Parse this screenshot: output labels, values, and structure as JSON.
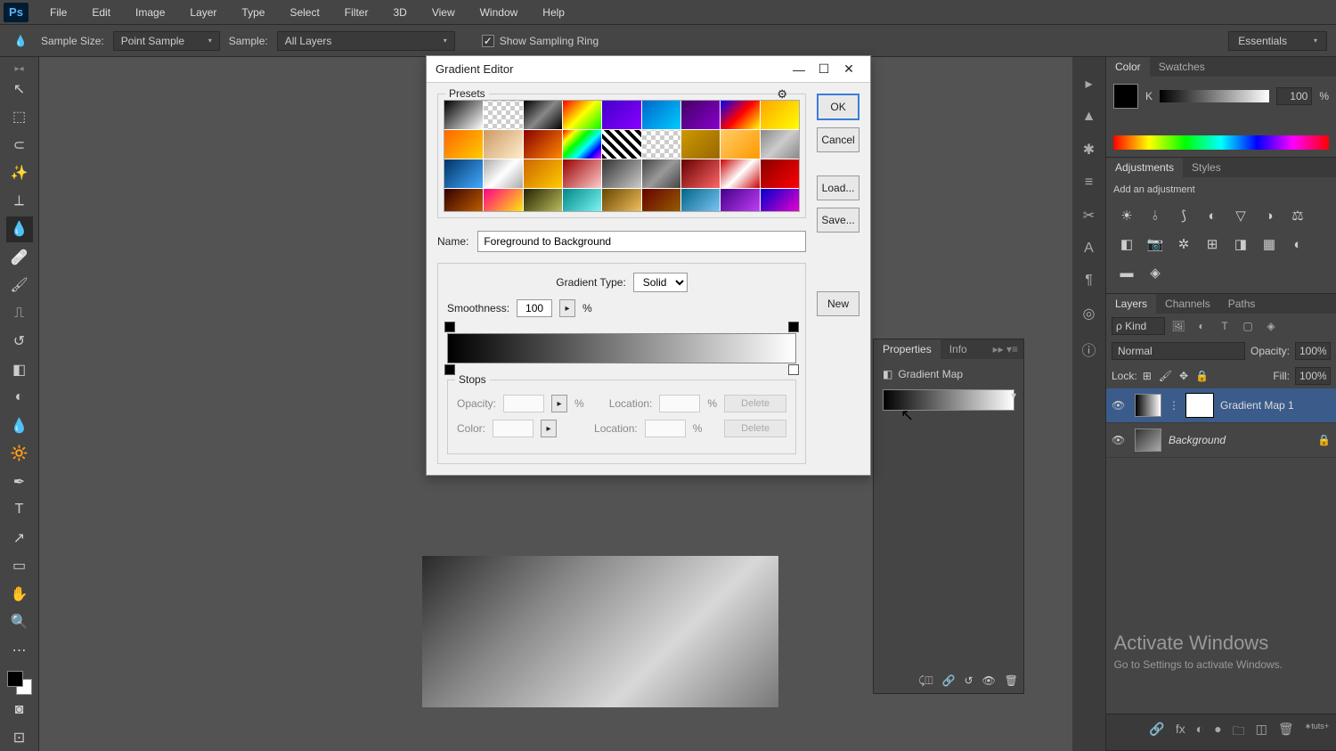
{
  "menubar": {
    "items": [
      "File",
      "Edit",
      "Image",
      "Layer",
      "Type",
      "Select",
      "Filter",
      "3D",
      "View",
      "Window",
      "Help"
    ]
  },
  "options": {
    "sample_size_label": "Sample Size:",
    "sample_size_value": "Point Sample",
    "sample_label": "Sample:",
    "sample_value": "All Layers",
    "checkbox_label": "Show Sampling Ring",
    "workspace": "Essentials"
  },
  "color_panel": {
    "tab_color": "Color",
    "tab_swatches": "Swatches",
    "k_label": "K",
    "k_value": "100",
    "pct": "%"
  },
  "adjustments": {
    "tab1": "Adjustments",
    "tab2": "Styles",
    "title": "Add an adjustment"
  },
  "layers_panel": {
    "tab_layers": "Layers",
    "tab_channels": "Channels",
    "tab_paths": "Paths",
    "kind_label": "Kind",
    "mode": "Normal",
    "opacity_label": "Opacity:",
    "opacity_value": "100%",
    "lock_label": "Lock:",
    "fill_label": "Fill:",
    "fill_value": "100%",
    "layer1": "Gradient Map 1",
    "layer2": "Background"
  },
  "properties": {
    "tab1": "Properties",
    "tab2": "Info",
    "title": "Gradient Map"
  },
  "dialog": {
    "title": "Gradient Editor",
    "presets_label": "Presets",
    "name_label": "Name:",
    "name_value": "Foreground to Background",
    "btn_ok": "OK",
    "btn_cancel": "Cancel",
    "btn_load": "Load...",
    "btn_save": "Save...",
    "btn_new": "New",
    "grad_type_label": "Gradient Type:",
    "grad_type_value": "Solid",
    "smooth_label": "Smoothness:",
    "smooth_value": "100",
    "pct": "%",
    "stops_label": "Stops",
    "opacity_label": "Opacity:",
    "location_label": "Location:",
    "color_label": "Color:",
    "delete_label": "Delete"
  },
  "activate": {
    "t1": "Activate Windows",
    "t2": "Go to Settings to activate Windows."
  },
  "preset_gradients": [
    "linear-gradient(135deg,#000,#fff)",
    "repeating-conic-gradient(#ccc 0 25%,#fff 0 50%) 0/10px 10px",
    "linear-gradient(135deg,#000,#888,#000)",
    "linear-gradient(135deg,red,yellow,lime)",
    "linear-gradient(135deg,#40c,#80f)",
    "linear-gradient(135deg,#06c,#0cf)",
    "linear-gradient(135deg,#406,#80c)",
    "linear-gradient(135deg,#00f,red,yellow)",
    "linear-gradient(135deg,orange,yellow)",
    "linear-gradient(135deg,#f60,#fc0)",
    "linear-gradient(135deg,#c96,#fec)",
    "linear-gradient(135deg,#800,#f80)",
    "linear-gradient(135deg,red,yellow,lime,cyan,blue,magenta)",
    "repeating-linear-gradient(45deg,#000 0 4px,#fff 4px 8px)",
    "repeating-conic-gradient(#ccc 0 25%,#fff 0 50%) 0/10px 10px",
    "linear-gradient(135deg,#c90,#960)",
    "linear-gradient(135deg,#fc6,#f90)",
    "linear-gradient(135deg,#888,#ccc,#888)",
    "linear-gradient(135deg,#036,#4af)",
    "linear-gradient(135deg,#aaa,#fff,#aaa)",
    "linear-gradient(135deg,#c60,#fc0)",
    "linear-gradient(135deg,#900,#fcc)",
    "linear-gradient(135deg,#333,#ccc)",
    "linear-gradient(135deg,#444,#999,#444)",
    "linear-gradient(135deg,#600,#f66)",
    "linear-gradient(135deg,#c00,#fff,#c00)",
    "linear-gradient(135deg,#800,#f00)",
    "linear-gradient(135deg,#300,#c60)",
    "linear-gradient(135deg,#f08,#ff0)",
    "linear-gradient(135deg,#220,#cc6)",
    "linear-gradient(135deg,#088,#8ff)",
    "linear-gradient(135deg,#640,#fc6)",
    "linear-gradient(135deg,#600,#960)",
    "linear-gradient(135deg,#068,#8cf)",
    "linear-gradient(135deg,#408,#c4f)",
    "linear-gradient(135deg,#00c,#f0c)"
  ]
}
